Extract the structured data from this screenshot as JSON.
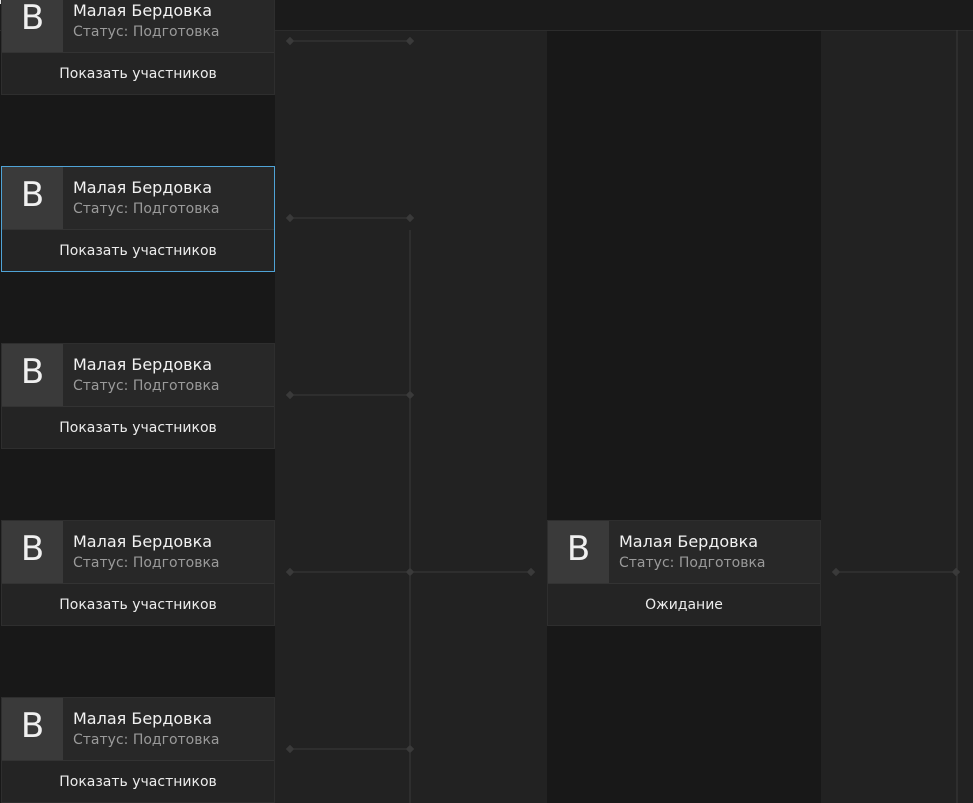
{
  "colors": {
    "background": "#1c1c1c",
    "column_dark": "#181818",
    "column_light": "#222222",
    "card": "#242424",
    "avatar": "#3a3a3a",
    "selected_border": "#4fa3d6",
    "connector": "#3a3a3a"
  },
  "bracket": {
    "round1": [
      {
        "avatar": "B",
        "name": "Малая Бердовка",
        "status": "Статус: Подготовка",
        "action": "Показать участников"
      },
      {
        "avatar": "B",
        "name": "Малая Бердовка",
        "status": "Статус: Подготовка",
        "action": "Показать участников"
      },
      {
        "avatar": "B",
        "name": "Малая Бердовка",
        "status": "Статус: Подготовка",
        "action": "Показать участников"
      },
      {
        "avatar": "B",
        "name": "Малая Бердовка",
        "status": "Статус: Подготовка",
        "action": "Показать участников"
      },
      {
        "avatar": "B",
        "name": "Малая Бердовка",
        "status": "Статус: Подготовка",
        "action": "Показать участников"
      }
    ],
    "round2": [
      {
        "avatar": "B",
        "name": "Малая Бердовка",
        "status": "Статус: Подготовка",
        "action": "Ожидание"
      }
    ]
  },
  "icons": {
    "topbar": "window-icon",
    "connector_node": "diamond-node-icon"
  }
}
